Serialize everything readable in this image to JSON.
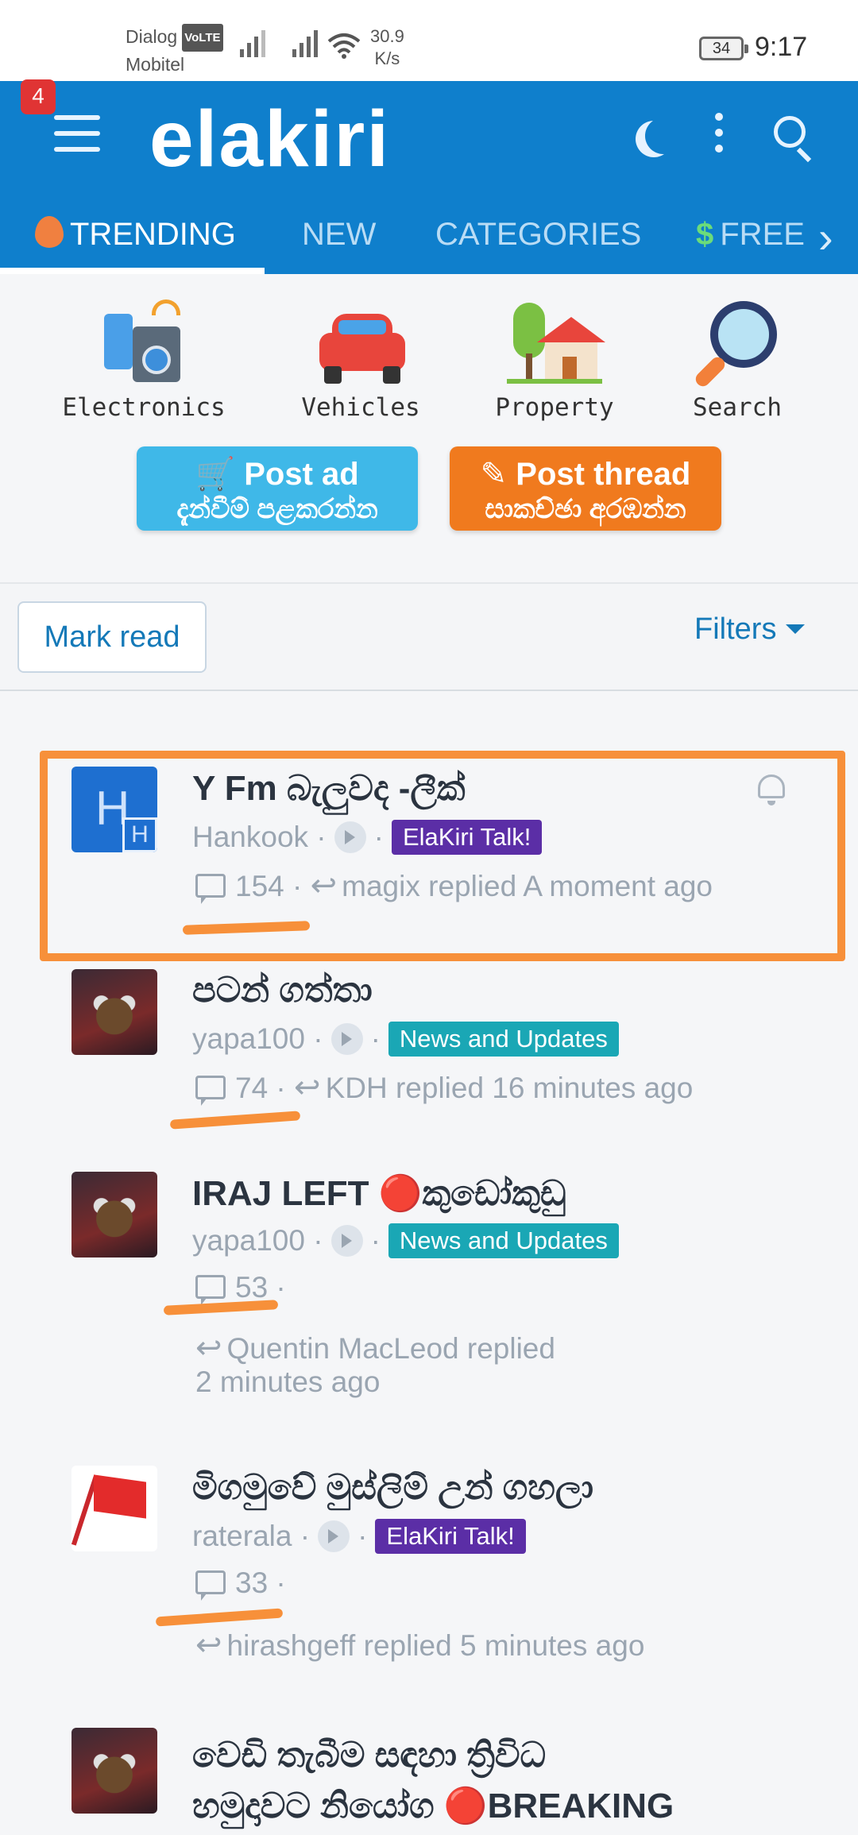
{
  "status_bar": {
    "carrier_1": "Dialog",
    "volte": "VoLTE",
    "carrier_2": "Mobitel",
    "speed_value": "30.9",
    "speed_unit": "K/s",
    "battery": "34",
    "time": "9:17"
  },
  "header": {
    "notification_count": "4",
    "logo": "elakiri"
  },
  "tabs": [
    {
      "label": "TRENDING"
    },
    {
      "label": "NEW"
    },
    {
      "label": "CATEGORIES"
    },
    {
      "label": "FREE"
    }
  ],
  "quick_links": [
    {
      "label": "Electronics"
    },
    {
      "label": "Vehicles"
    },
    {
      "label": "Property"
    },
    {
      "label": "Search"
    }
  ],
  "post_ad": {
    "line1": "Post ad",
    "line2": "දැන්වීම් පළකරන්න",
    "color": "#3fb8e8"
  },
  "post_thread": {
    "line1": "Post thread",
    "line2": "සාකච්ඡා අරඹන්න",
    "color": "#f07a1e"
  },
  "toolbar": {
    "mark_read": "Mark read",
    "filters": "Filters"
  },
  "threads": [
    {
      "title": "Y Fm බැලුවද -ලීක්",
      "author": "Hankook",
      "forum": "ElaKiri Talk!",
      "forum_color": "#5b2ea6",
      "replies": "154",
      "last": "magix replied A moment ago",
      "avatar_letter": "H"
    },
    {
      "title": "පටන් ගත්තා",
      "author": "yapa100",
      "forum": "News and Updates",
      "forum_color": "#1aa7b5",
      "replies": "74",
      "last": "KDH replied 16 minutes ago"
    },
    {
      "title": "IRAJ LEFT 🔴කුඩෝකුඩු",
      "author": "yapa100",
      "forum": "News and Updates",
      "forum_color": "#1aa7b5",
      "replies": "53",
      "last_line1": "Quentin MacLeod replied",
      "last_line2": "2 minutes ago"
    },
    {
      "title": "මිගමුවේ මුස්ලිම් උන් ගහලා",
      "author": "raterala",
      "forum": "ElaKiri Talk!",
      "forum_color": "#5b2ea6",
      "replies": "33",
      "last": "hirashgeff replied 5 minutes ago"
    },
    {
      "title_line1": "වෙඩි තැබීම සඳහා ත්‍රිවිධ",
      "title_line2": "හමුදාවට නියෝග 🔴BREAKING"
    }
  ]
}
